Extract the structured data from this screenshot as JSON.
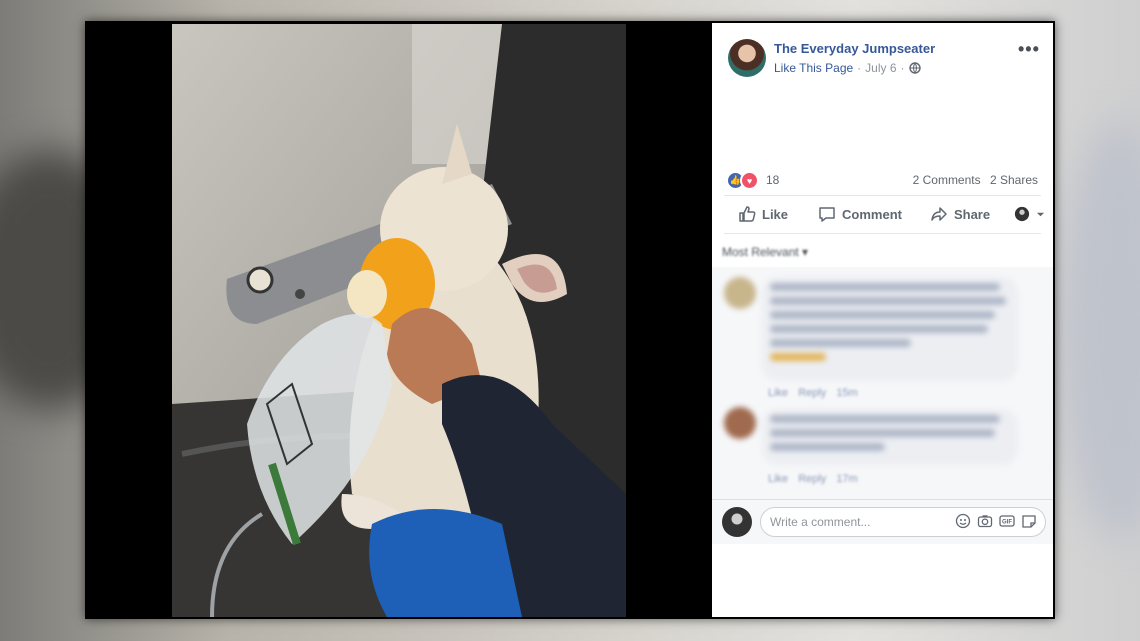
{
  "post": {
    "page_name": "The Everyday Jumpseater",
    "like_page": "Like This Page",
    "separator": "·",
    "date": "July 6",
    "more": "•••"
  },
  "reactions": {
    "count": "18",
    "comments": "2 Comments",
    "shares": "2 Shares"
  },
  "actions": {
    "like": "Like",
    "comment": "Comment",
    "share": "Share"
  },
  "comments_section": {
    "sort_label": "Most Relevant ▾",
    "comments": [
      {
        "like": "Like",
        "reply": "Reply",
        "time": "15m"
      },
      {
        "like": "Like",
        "reply": "Reply",
        "time": "17m"
      }
    ],
    "placeholder": "Write a comment..."
  },
  "colors": {
    "link_blue": "#365899",
    "like_blue": "#4267b2",
    "love_red": "#f25268",
    "text_gray": "#606770"
  },
  "icons": [
    "like-reaction-icon",
    "love-reaction-icon",
    "thumbs-up-icon",
    "comment-icon",
    "share-icon",
    "globe-icon",
    "emoji-icon",
    "camera-icon",
    "gif-icon",
    "sticker-icon"
  ]
}
